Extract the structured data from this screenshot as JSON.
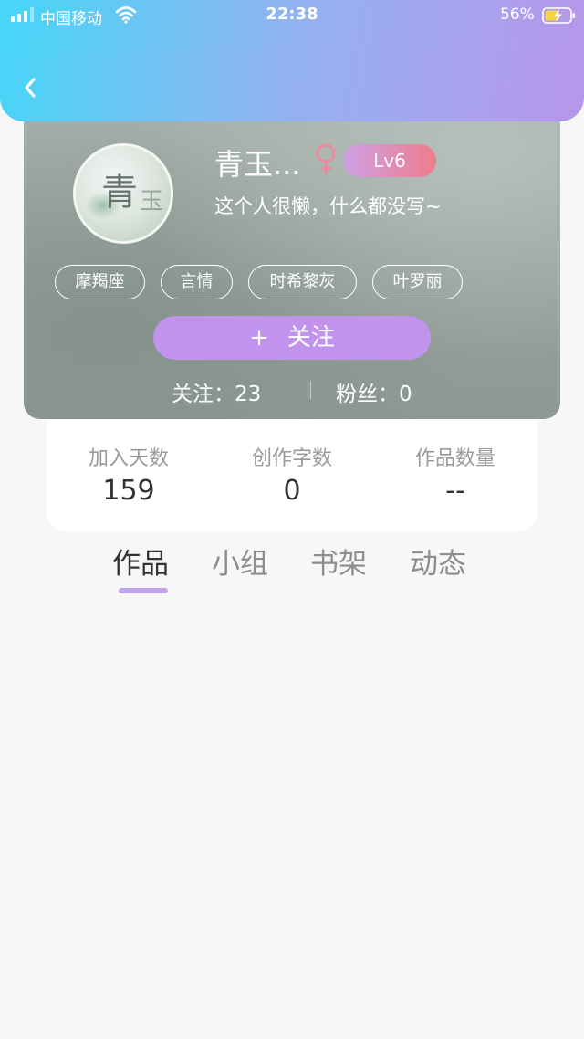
{
  "status_bar": {
    "carrier": "中国移动",
    "time": "22:38",
    "battery_percent": "56%",
    "icons": [
      "signal-icon",
      "wifi-icon",
      "battery-charging-icon"
    ]
  },
  "nav": {
    "back_icon": "chevron-left-icon"
  },
  "profile": {
    "username": "青玉...",
    "gender_icon": "female-symbol-icon",
    "level": "Lv6",
    "bio": "这个人很懒，什么都没写~",
    "tags": [
      "摩羯座",
      "言情",
      "时希黎灰",
      "叶罗丽"
    ],
    "follow_button": {
      "plus": "+",
      "label": "关注"
    },
    "following_label": "关注：23",
    "fans_label": "粉丝：0"
  },
  "stats": [
    {
      "label": "加入天数",
      "value": "159"
    },
    {
      "label": "创作字数",
      "value": "0"
    },
    {
      "label": "作品数量",
      "value": "--"
    }
  ],
  "tabs": [
    {
      "label": "作品",
      "active": true
    },
    {
      "label": "小组",
      "active": false
    },
    {
      "label": "书架",
      "active": false
    },
    {
      "label": "动态",
      "active": false
    }
  ],
  "colors": {
    "header_gradient": [
      "#45d6f8",
      "#b896ea"
    ],
    "accent_purple": "#c193ec",
    "level_badge_gradient": [
      "#cfa0e6",
      "#ee7d8a"
    ],
    "gender_pink": "#e98a9d",
    "tab_indicator": "#c2a4ea"
  }
}
